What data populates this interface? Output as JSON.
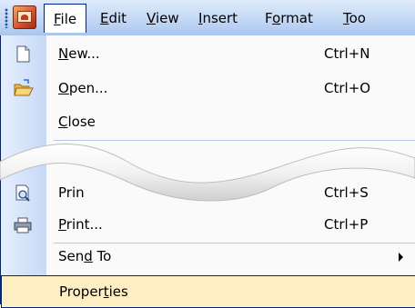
{
  "menubar": {
    "app_icon": "word-document-app-icon",
    "items": [
      {
        "label": "File",
        "mnemonic": "F",
        "rest": "ile",
        "active": true
      },
      {
        "label": "Edit",
        "mnemonic": "E",
        "rest": "dit"
      },
      {
        "label": "View",
        "mnemonic": "V",
        "rest": "iew"
      },
      {
        "label": "Insert",
        "mnemonic": "I",
        "rest": "nsert"
      },
      {
        "label": "Format",
        "pre": "F",
        "mnemonic": "o",
        "rest": "rmat"
      },
      {
        "label": "Too",
        "mnemonic": "T",
        "rest": "oo"
      }
    ]
  },
  "file_menu": {
    "items": [
      {
        "pre": "",
        "mnemonic": "N",
        "rest": "ew...",
        "shortcut": "Ctrl+N",
        "icon": "new-document-icon"
      },
      {
        "pre": "",
        "mnemonic": "O",
        "rest": "pen...",
        "shortcut": "Ctrl+O",
        "icon": "open-folder-icon"
      },
      {
        "pre": "",
        "mnemonic": "C",
        "rest": "lose",
        "shortcut": "",
        "icon": ""
      },
      {
        "pre": "Prin",
        "mnemonic": "",
        "rest": "",
        "shortcut": "Ctrl+S",
        "icon": "print-preview-icon"
      },
      {
        "pre": "",
        "mnemonic": "P",
        "rest": "rint...",
        "shortcut": "Ctrl+P",
        "icon": "printer-icon"
      },
      {
        "pre": "Sen",
        "mnemonic": "d",
        "rest": " To",
        "shortcut": "",
        "icon": "",
        "submenu": true
      },
      {
        "pre": "Proper",
        "mnemonic": "t",
        "rest": "ies",
        "shortcut": "",
        "icon": "",
        "highlighted": true
      }
    ]
  },
  "colors": {
    "menubar_top": "#ddeafb",
    "menubar_bottom": "#a9c4ee",
    "highlight": "#ffeec2",
    "border": "#00267f"
  }
}
